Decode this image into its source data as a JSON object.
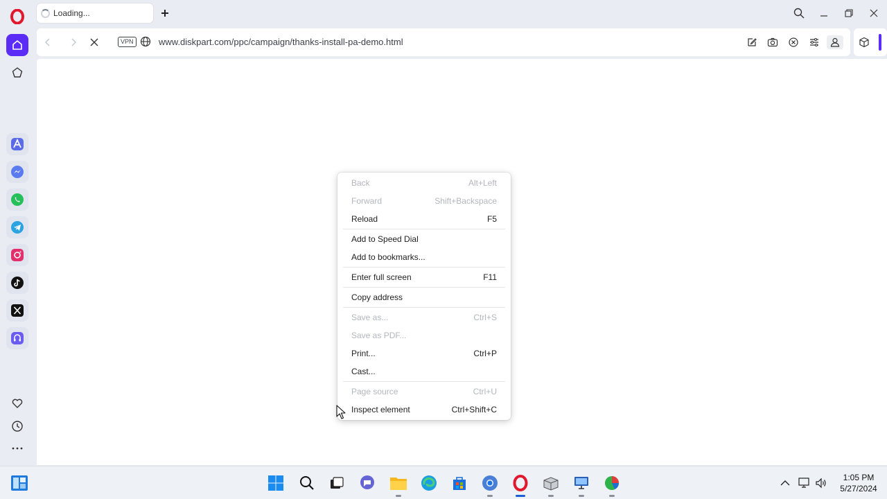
{
  "tab": {
    "title": "Loading..."
  },
  "address": {
    "vpn_label": "VPN",
    "url": "www.diskpart.com/ppc/campaign/thanks-install-pa-demo.html"
  },
  "sidebar": {
    "apps": [
      "aria-icon",
      "messenger-icon",
      "whatsapp-icon",
      "telegram-icon",
      "instagram-icon",
      "tiktok-icon",
      "x-icon",
      "player-icon"
    ]
  },
  "context_menu": {
    "items": [
      {
        "label": "Back",
        "shortcut": "Alt+Left",
        "disabled": true
      },
      {
        "label": "Forward",
        "shortcut": "Shift+Backspace",
        "disabled": true
      },
      {
        "label": "Reload",
        "shortcut": "F5",
        "disabled": false
      },
      {
        "label": "Add to Speed Dial",
        "shortcut": "",
        "disabled": false
      },
      {
        "label": "Add to bookmarks...",
        "shortcut": "",
        "disabled": false
      },
      {
        "label": "Enter full screen",
        "shortcut": "F11",
        "disabled": false
      },
      {
        "label": "Copy address",
        "shortcut": "",
        "disabled": false
      },
      {
        "label": "Save as...",
        "shortcut": "Ctrl+S",
        "disabled": true
      },
      {
        "label": "Save as PDF...",
        "shortcut": "",
        "disabled": true
      },
      {
        "label": "Print...",
        "shortcut": "Ctrl+P",
        "disabled": false
      },
      {
        "label": "Cast...",
        "shortcut": "",
        "disabled": false
      },
      {
        "label": "Page source",
        "shortcut": "Ctrl+U",
        "disabled": true
      },
      {
        "label": "Inspect element",
        "shortcut": "Ctrl+Shift+C",
        "disabled": false
      }
    ]
  },
  "taskbar": {
    "time": "1:05 PM",
    "date": "5/27/2024"
  },
  "colors": {
    "accent": "#5a2cf5",
    "opera_red": "#e0192e"
  }
}
